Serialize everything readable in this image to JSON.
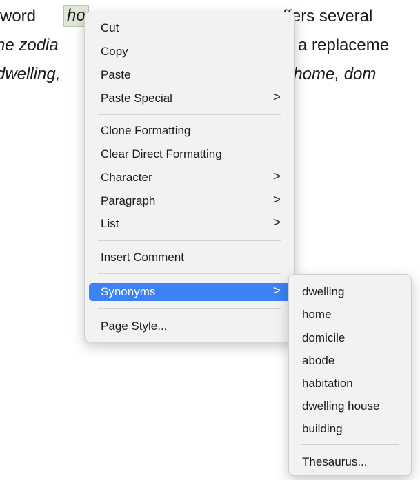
{
  "document": {
    "line1_pre": "word ",
    "line1_word": "ho",
    "line1_post": "ffers several",
    "line2_pre": "ne zodia",
    "line2_post": "a replaceme",
    "line3_pre": "dwelling,",
    "line3_post": ", home, dom"
  },
  "context_menu": {
    "items": [
      {
        "label": "Cut"
      },
      {
        "label": "Copy"
      },
      {
        "label": "Paste"
      },
      {
        "label": "Paste Special",
        "arrow": ">"
      },
      {
        "label": "Clone Formatting"
      },
      {
        "label": "Clear Direct Formatting"
      },
      {
        "label": "Character",
        "arrow": ">"
      },
      {
        "label": "Paragraph",
        "arrow": ">"
      },
      {
        "label": "List",
        "arrow": ">"
      },
      {
        "label": "Insert Comment"
      },
      {
        "label": "Synonyms",
        "arrow": ">"
      },
      {
        "label": "Page Style..."
      }
    ],
    "highlight_color": "#3a82f6"
  },
  "synonyms_submenu": {
    "items": [
      {
        "label": "dwelling"
      },
      {
        "label": "home"
      },
      {
        "label": "domicile"
      },
      {
        "label": "abode"
      },
      {
        "label": "habitation"
      },
      {
        "label": "dwelling house"
      },
      {
        "label": "building"
      },
      {
        "label": "Thesaurus..."
      }
    ]
  },
  "icons": {
    "submenu_arrow": "chevron-right-icon"
  }
}
